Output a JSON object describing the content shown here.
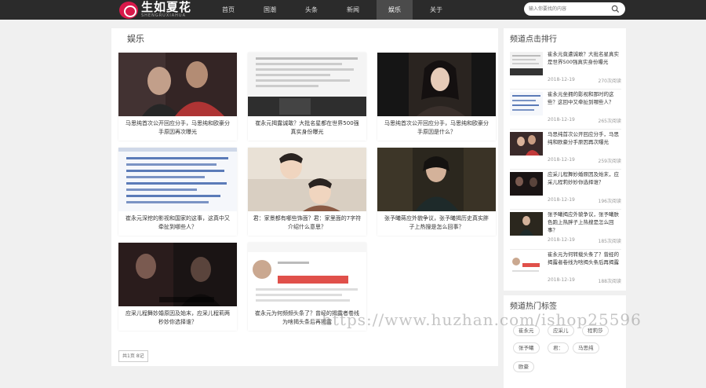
{
  "header": {
    "logo_text": "生如夏花",
    "logo_subtext": "SHENGRUXIAHUA",
    "nav": [
      "首页",
      "国潮",
      "头条",
      "新闻",
      "娱乐",
      "关于"
    ],
    "active_nav": "娱乐",
    "search_placeholder": "输入你要找的内容"
  },
  "main": {
    "section_title": "娱乐",
    "cards": [
      {
        "title": "马思纯首次公开回应分手，马思纯和欧豪分手原因再次曝光"
      },
      {
        "title": "崔永元揭露诚敢？大批名星都在世界500强真实身份曝光"
      },
      {
        "title": "马思纯首次公开回应分手，马思纯和欧豪分手原因是什么？"
      },
      {
        "title": "崔永元深挖的影视和国家的这事，这真中又牵扯到哪些人？"
      },
      {
        "title": "君：家景都有哪些饰面？君：家里面的7字符介绍什么意思？"
      },
      {
        "title": "张予曦蒋应外貌争议，张予曦揭历史真实胖子上热搜是怎么回事？"
      },
      {
        "title": "应采儿程舞妙婚原因及始末，应采儿程莉两秒妙你选择谁？"
      },
      {
        "title": "崔永元为何频频头条了？曾经的揭露者卷线为啥揭头条后再揭露"
      }
    ],
    "pager_label": "共1页 8记"
  },
  "sidebar": {
    "rank_title": "频道点击排行",
    "rank_items": [
      {
        "title": "崔永元竟遭诚敢？大批名星真实是世界500强真实身份曝光",
        "date": "2018-12-19",
        "views": "270次阅读"
      },
      {
        "title": "崔永元坐拥的影视和那时的这些？这回中又牵扯到哪些人？",
        "date": "2018-12-19",
        "views": "265次阅读"
      },
      {
        "title": "马思纯首次公开回应分手，马思纯和欧豪分手原因再次曝光",
        "date": "2018-12-19",
        "views": "259次阅读"
      },
      {
        "title": "应采儿程舞妙婚原因及始末，应采儿程莉妙妙你选择谁？",
        "date": "2018-12-19",
        "views": "196次阅读"
      },
      {
        "title": "张予曦揭应外貌争议，张予曦肤色跑上热胖子上热搜是怎么回事？",
        "date": "2018-12-19",
        "views": "185次阅读"
      },
      {
        "title": "崔永元为何转载头条了？曾经的揭露者卷线为啥揭头条后再揭露",
        "date": "2018-12-19",
        "views": "188次阅读"
      }
    ],
    "tags_title": "频道热门标签",
    "tags": [
      "崔永元",
      "应采儿",
      "程莉莎",
      "张予曦",
      "君：",
      "马思纯",
      "欧豪"
    ]
  },
  "watermark": "https://www.huzhan.com/ishop25596"
}
